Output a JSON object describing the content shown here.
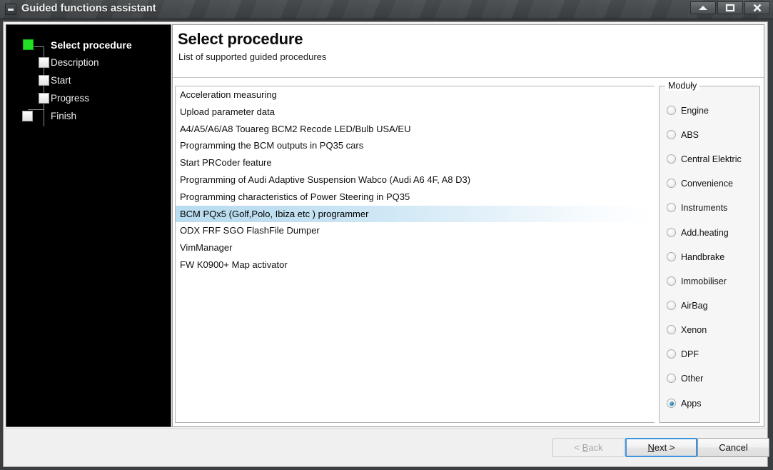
{
  "window": {
    "title": "Guided functions assistant",
    "sysmenu_icon": "minus-box-icon",
    "buttons": [
      {
        "name": "minimize",
        "icon": "up-arrow-icon"
      },
      {
        "name": "maximize",
        "icon": "square-icon"
      },
      {
        "name": "close",
        "icon": "x-icon"
      }
    ]
  },
  "sidebar": {
    "steps": [
      {
        "label": "Select procedure",
        "state": "active"
      },
      {
        "label": "Description",
        "state": "pending"
      },
      {
        "label": "Start",
        "state": "pending"
      },
      {
        "label": "Progress",
        "state": "pending"
      },
      {
        "label": "Finish",
        "state": "pending"
      }
    ]
  },
  "page": {
    "title": "Select procedure",
    "subtitle": "List of supported guided procedures"
  },
  "procedures": {
    "items": [
      "Acceleration measuring",
      "Upload parameter data",
      "A4/A5/A6/A8 Touareg BCM2 Recode LED/Bulb USA/EU",
      "Programming the BCM outputs in PQ35 cars",
      "Start PRCoder feature",
      "Programming of Audi Adaptive Suspension Wabco (Audi A6 4F, A8 D3)",
      "Programming characteristics of Power Steering in PQ35",
      "BCM PQx5 (Golf,Polo, Ibiza etc ) programmer",
      "ODX FRF SGO FlashFile Dumper",
      "VimManager",
      "FW K0900+ Map activator"
    ],
    "selected_index": 7
  },
  "modules": {
    "legend": "Moduły",
    "items": [
      {
        "label": "Engine",
        "checked": false
      },
      {
        "label": "ABS",
        "checked": false
      },
      {
        "label": "Central Elektric",
        "checked": false
      },
      {
        "label": "Convenience",
        "checked": false
      },
      {
        "label": "Instruments",
        "checked": false
      },
      {
        "label": "Add.heating",
        "checked": false
      },
      {
        "label": "Handbrake",
        "checked": false
      },
      {
        "label": "Immobiliser",
        "checked": false
      },
      {
        "label": "AirBag",
        "checked": false
      },
      {
        "label": "Xenon",
        "checked": false
      },
      {
        "label": "DPF",
        "checked": false
      },
      {
        "label": "Other",
        "checked": false
      },
      {
        "label": "Apps",
        "checked": true
      }
    ],
    "selected_index": 12
  },
  "footer": {
    "back": {
      "label": "< Back",
      "mnemonic": "B",
      "disabled": true
    },
    "next": {
      "label": "Next >",
      "mnemonic": "N",
      "default": true
    },
    "cancel": {
      "label": "Cancel",
      "disabled": false
    }
  },
  "colors": {
    "titlebar": "#44484a",
    "sidebar_bg": "#000000",
    "active_step": "#22e022",
    "selection": "#b8dcf0",
    "focus_border": "#3c94dd"
  }
}
